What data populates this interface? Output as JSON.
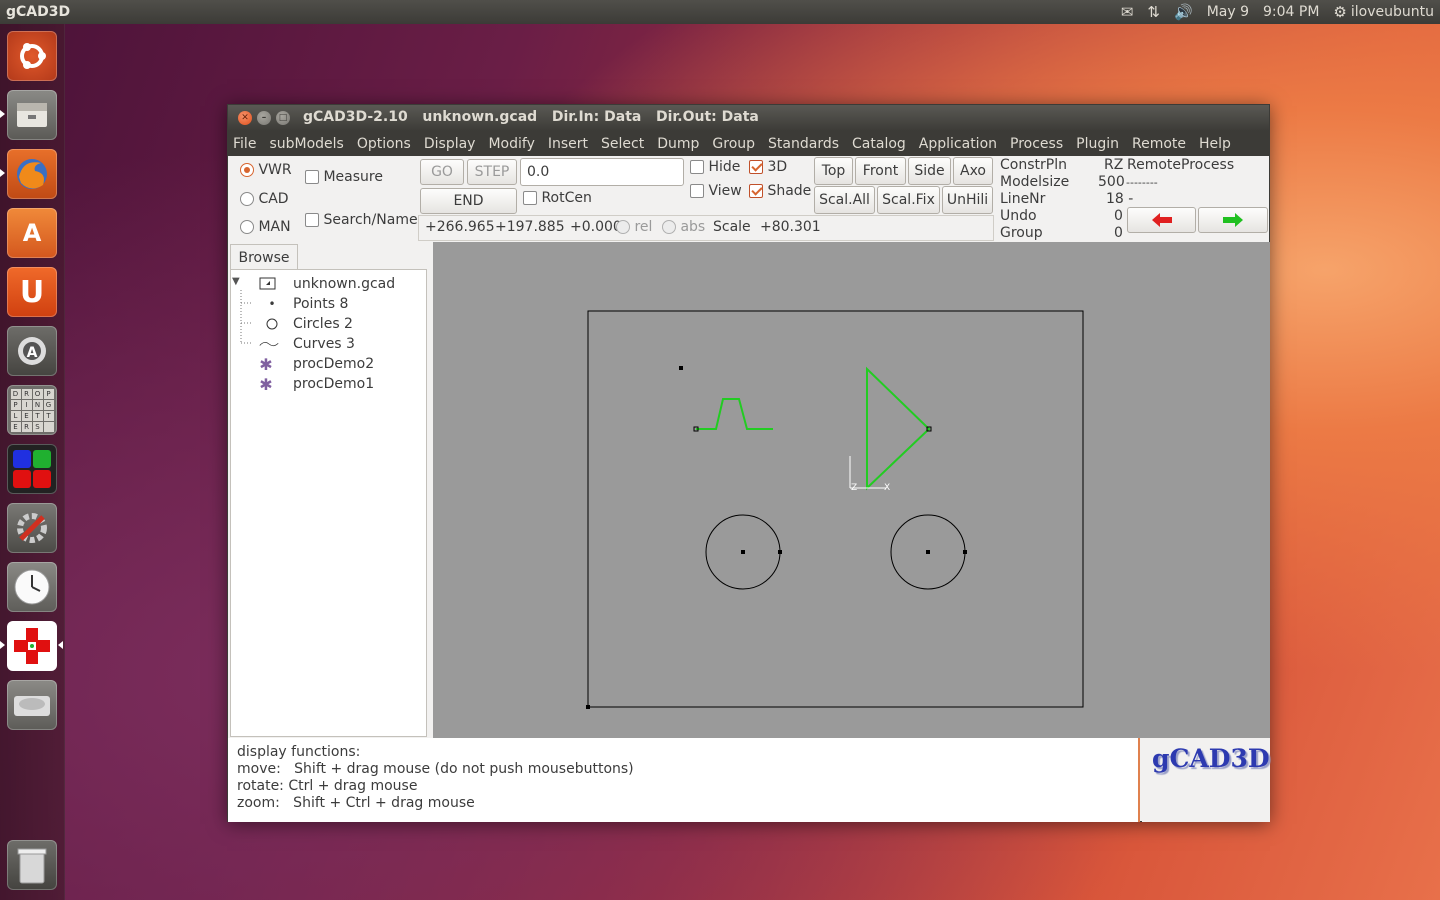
{
  "top_panel": {
    "app_title": "gCAD3D",
    "date": "May 9",
    "time": "9:04 PM",
    "user": "iloveubuntu",
    "icons": [
      "mail-icon",
      "network-icon",
      "volume-icon",
      "settings-gear-icon"
    ]
  },
  "launcher": {
    "items": [
      "ubuntu-dash-icon",
      "file-manager-icon",
      "firefox-icon",
      "software-center-icon",
      "ubuntu-one-icon",
      "update-manager-icon",
      "letter-game-icon",
      "color-app-icon",
      "system-settings-icon",
      "clock-icon",
      "gcad3d-icon",
      "disk-drive-icon",
      "trash-icon"
    ],
    "letter_grid": [
      "D",
      "R",
      "O",
      "P",
      "P",
      "I",
      "N",
      "G",
      "L",
      "E",
      "T",
      "T",
      "E",
      "R",
      "S",
      ""
    ]
  },
  "window": {
    "title": "gCAD3D-2.10",
    "file": "unknown.gcad",
    "dir_in": "Dir.In: Data",
    "dir_out": "Dir.Out: Data"
  },
  "menu": [
    "File",
    "subModels",
    "Options",
    "Display",
    "Modify",
    "Insert",
    "Select",
    "Dump",
    "Group",
    "Standards",
    "Catalog",
    "Application",
    "Process",
    "Plugin",
    "Remote",
    "Help"
  ],
  "toolbar": {
    "modes": [
      {
        "label": "VWR",
        "selected": true
      },
      {
        "label": "CAD",
        "selected": false
      },
      {
        "label": "MAN",
        "selected": false
      }
    ],
    "measure_label": "Measure",
    "search_label": "Search/Name",
    "go_label": "GO",
    "step_label": "STEP",
    "input_value": "0.0",
    "end_label": "END",
    "rotcen_label": "RotCen",
    "hide_label": "Hide",
    "view_label": "View",
    "threed_label": "3D",
    "shade_label": "Shade",
    "view_buttons": [
      "Top",
      "Front",
      "Side",
      "Axo"
    ],
    "scale_buttons": [
      "Scal.All",
      "Scal.Fix",
      "UnHili"
    ],
    "coord_x": "+266.965",
    "coord_y": "+197.885",
    "coord_z": "+0.000",
    "rel_label": "rel",
    "abs_label": "abs",
    "scale_label": "Scale",
    "scale_value": "+80.301"
  },
  "info": {
    "constrpln_label": "ConstrPln",
    "constrpln_value": "RZ",
    "remote_label": "RemoteProcess",
    "modelsize_label": "Modelsize",
    "modelsize_value": "500",
    "modelsize_dashes": "--------",
    "linenr_label": "LineNr",
    "linenr_value": "18 -",
    "undo_label": "Undo",
    "undo_value": "0",
    "group_label": "Group",
    "group_value": "0",
    "prev_arrow_color": "#e02020",
    "next_arrow_color": "#20c020"
  },
  "browse": {
    "tab_label": "Browse",
    "root": "unknown.gcad",
    "items": [
      {
        "label": "Points 8",
        "icon": "point-icon"
      },
      {
        "label": "Circles 2",
        "icon": "circle-icon"
      },
      {
        "label": "Curves 3",
        "icon": "curve-icon"
      },
      {
        "label": "procDemo2",
        "icon": "gear-process-icon"
      },
      {
        "label": "procDemo1",
        "icon": "gear-process-icon"
      }
    ]
  },
  "canvas": {
    "background": "#9a9a9a",
    "geometry_color": "#22cc22",
    "axis_labels": [
      "Z",
      "X"
    ]
  },
  "messages": [
    "display functions:",
    "move:   Shift + drag mouse (do not push mousebuttons)",
    "rotate: Ctrl + drag mouse",
    "zoom:   Shift + Ctrl + drag mouse"
  ],
  "logo_text": "gCAD3D"
}
